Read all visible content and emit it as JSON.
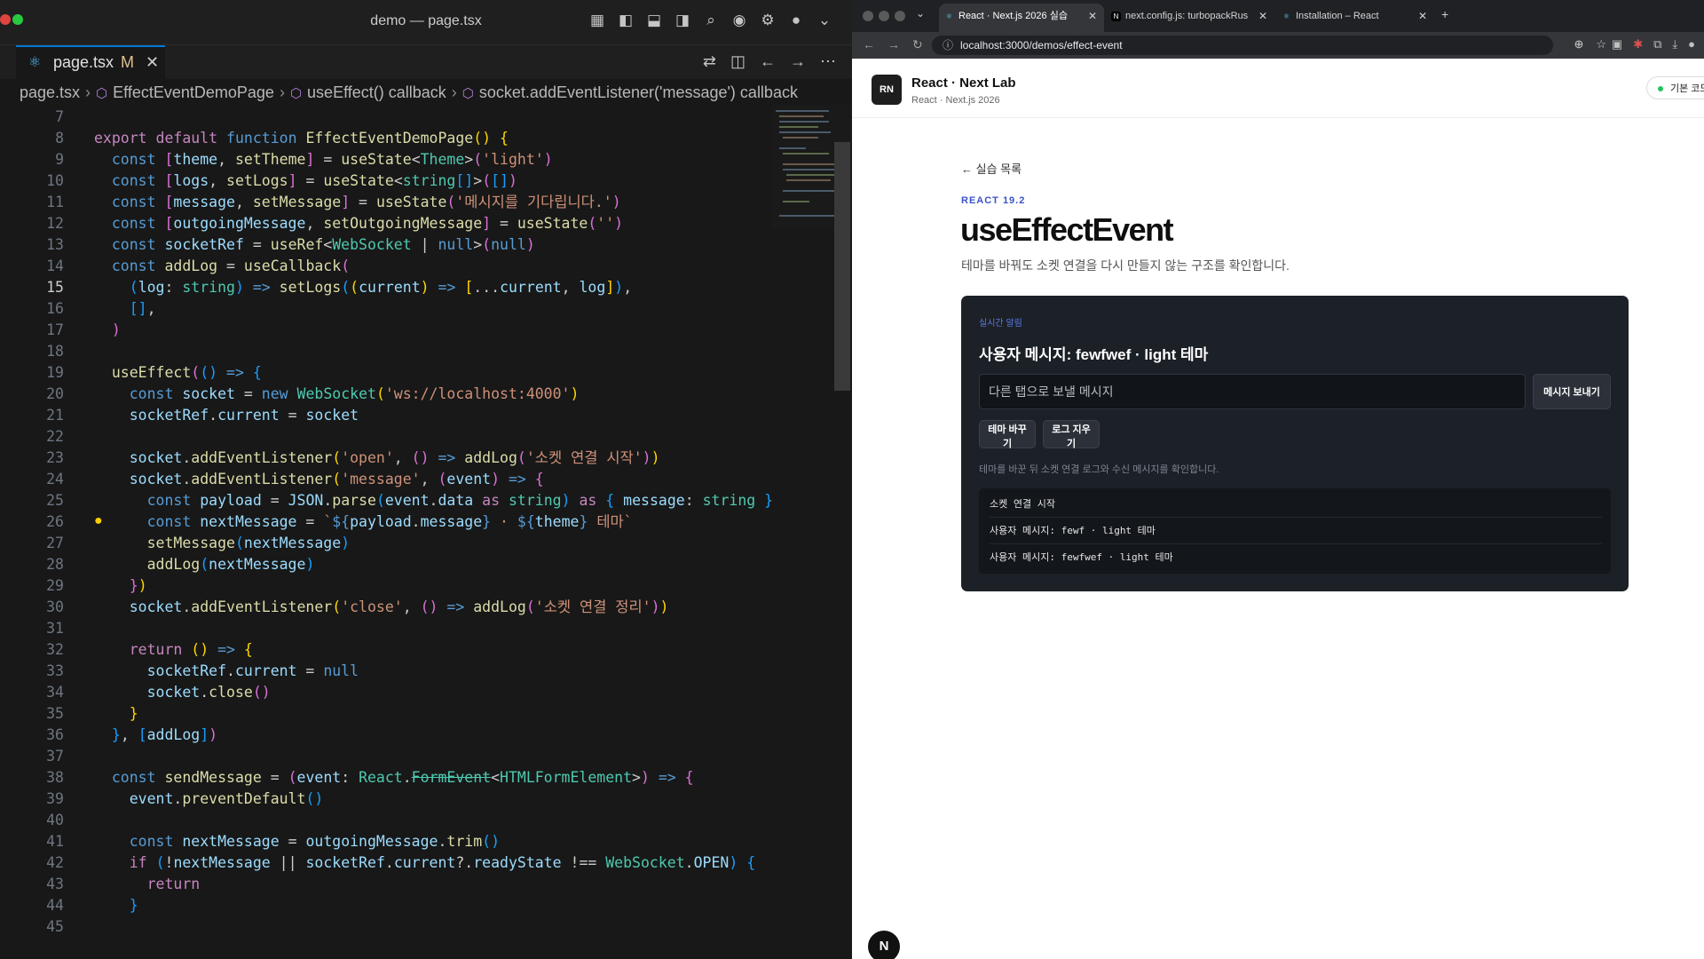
{
  "editor": {
    "window_title": "demo — page.tsx",
    "tab": {
      "icon": "⚛",
      "name": "page.tsx",
      "modified": "M",
      "close": "✕"
    },
    "breadcrumb": [
      "page.tsx",
      "EffectEventDemoPage",
      "useEffect() callback",
      "socket.addEventListener('message') callback"
    ],
    "active_line": "15",
    "lines": [
      {
        "n": "7",
        "html": ""
      },
      {
        "n": "8",
        "html": "<span class=\"kc\">export</span> <span class=\"kc\">default</span> <span class=\"kw\">function</span> <span class=\"fn\">EffectEventDemoPage</span><span class=\"bk1\">()</span> <span class=\"bk1\">{</span>"
      },
      {
        "n": "9",
        "html": "  <span class=\"kw\">const</span> <span class=\"bk2\">[</span><span class=\"vr\">theme</span>, <span class=\"fn\">setTheme</span><span class=\"bk2\">]</span> = <span class=\"fn\">useState</span>&lt;<span class=\"ty\">Theme</span>&gt;<span class=\"bk2\">(</span><span class=\"st\">'light'</span><span class=\"bk2\">)</span>"
      },
      {
        "n": "10",
        "html": "  <span class=\"kw\">const</span> <span class=\"bk2\">[</span><span class=\"vr\">logs</span>, <span class=\"fn\">setLogs</span><span class=\"bk2\">]</span> = <span class=\"fn\">useState</span>&lt;<span class=\"ty\">string</span><span class=\"bk3\">[]</span>&gt;<span class=\"bk2\">(</span><span class=\"bk3\">[]</span><span class=\"bk2\">)</span>"
      },
      {
        "n": "11",
        "html": "  <span class=\"kw\">const</span> <span class=\"bk2\">[</span><span class=\"vr\">message</span>, <span class=\"fn\">setMessage</span><span class=\"bk2\">]</span> = <span class=\"fn\">useState</span><span class=\"bk2\">(</span><span class=\"st\">'메시지를 기다립니다.'</span><span class=\"bk2\">)</span>"
      },
      {
        "n": "12",
        "html": "  <span class=\"kw\">const</span> <span class=\"bk2\">[</span><span class=\"vr\">outgoingMessage</span>, <span class=\"fn\">setOutgoingMessage</span><span class=\"bk2\">]</span> = <span class=\"fn\">useState</span><span class=\"bk2\">(</span><span class=\"st\">''</span><span class=\"bk2\">)</span>"
      },
      {
        "n": "13",
        "html": "  <span class=\"kw\">const</span> <span class=\"vr\">socketRef</span> = <span class=\"fn\">useRef</span>&lt;<span class=\"ty\">WebSocket</span> | <span class=\"kw\">null</span>&gt;<span class=\"bk2\">(</span><span class=\"kw\">null</span><span class=\"bk2\">)</span>"
      },
      {
        "n": "14",
        "html": "  <span class=\"kw\">const</span> <span class=\"fn\">addLog</span> = <span class=\"fn\">useCallback</span><span class=\"bk2\">(</span>"
      },
      {
        "n": "15",
        "html": "    <span class=\"bk3\">(</span><span class=\"vr\">log</span>: <span class=\"ty\">string</span><span class=\"bk3\">)</span> <span class=\"kw\">=&gt;</span> <span class=\"fn\">setLogs</span><span class=\"bk3\">(</span><span class=\"bk1\">(</span><span class=\"vr\">current</span><span class=\"bk1\">)</span> <span class=\"kw\">=&gt;</span> <span class=\"bk1\">[</span>...<span class=\"vr\">current</span>, <span class=\"vr\">log</span><span class=\"bk1\">]</span><span class=\"bk3\">)</span>,"
      },
      {
        "n": "16",
        "html": "    <span class=\"bk3\">[]</span>,"
      },
      {
        "n": "17",
        "html": "  <span class=\"bk2\">)</span>"
      },
      {
        "n": "18",
        "html": ""
      },
      {
        "n": "19",
        "html": "  <span class=\"fn\">useEffect</span><span class=\"bk2\">(</span><span class=\"bk3\">()</span> <span class=\"kw\">=&gt;</span> <span class=\"bk3\">{</span>"
      },
      {
        "n": "20",
        "html": "    <span class=\"kw\">const</span> <span class=\"vr\">socket</span> = <span class=\"kw\">new</span> <span class=\"ty\">WebSocket</span><span class=\"bk1\">(</span><span class=\"st\">'ws://localhost:4000'</span><span class=\"bk1\">)</span>"
      },
      {
        "n": "21",
        "html": "    <span class=\"vr\">socketRef</span>.<span class=\"vr\">current</span> = <span class=\"vr\">socket</span>"
      },
      {
        "n": "22",
        "html": ""
      },
      {
        "n": "23",
        "html": "    <span class=\"vr\">socket</span>.<span class=\"fn\">addEventListener</span><span class=\"bk1\">(</span><span class=\"st\">'open'</span>, <span class=\"bk2\">()</span> <span class=\"kw\">=&gt;</span> <span class=\"fn\">addLog</span><span class=\"bk2\">(</span><span class=\"st\">'소켓 연결 시작'</span><span class=\"bk2\">)</span><span class=\"bk1\">)</span>"
      },
      {
        "n": "24",
        "html": "    <span class=\"vr\">socket</span>.<span class=\"fn\">addEventListener</span><span class=\"bk1\">(</span><span class=\"st\">'message'</span>, <span class=\"bk2\">(</span><span class=\"vr\">event</span><span class=\"bk2\">)</span> <span class=\"kw\">=&gt;</span> <span class=\"bk2\">{</span>"
      },
      {
        "n": "25",
        "html": "      <span class=\"kw\">const</span> <span class=\"vr\">payload</span> = <span class=\"vr\">JSON</span>.<span class=\"fn\">parse</span><span class=\"bk3\">(</span><span class=\"vr\">event</span>.<span class=\"vr\">data</span> <span class=\"kc\">as</span> <span class=\"ty\">string</span><span class=\"bk3\">)</span> <span class=\"kc\">as</span> <span class=\"bk3\">{</span> <span class=\"vr\">message</span>: <span class=\"ty\">string</span> <span class=\"bk3\">}</span>"
      },
      {
        "n": "26",
        "html": "      <span class=\"kw\">const</span> <span class=\"vr\">nextMessage</span> = <span class=\"st\">`</span><span class=\"kw\">${</span><span class=\"vr\">payload</span>.<span class=\"vr\">message</span><span class=\"kw\">}</span><span class=\"st\"> · </span><span class=\"kw\">${</span><span class=\"vr\">theme</span><span class=\"kw\">}</span><span class=\"st\"> 테마`</span>"
      },
      {
        "n": "27",
        "html": "      <span class=\"fn\">setMessage</span><span class=\"bk3\">(</span><span class=\"vr\">nextMessage</span><span class=\"bk3\">)</span>"
      },
      {
        "n": "28",
        "html": "      <span class=\"fn\">addLog</span><span class=\"bk3\">(</span><span class=\"vr\">nextMessage</span><span class=\"bk3\">)</span>"
      },
      {
        "n": "29",
        "html": "    <span class=\"bk2\">}</span><span class=\"bk1\">)</span>"
      },
      {
        "n": "30",
        "html": "    <span class=\"vr\">socket</span>.<span class=\"fn\">addEventListener</span><span class=\"bk1\">(</span><span class=\"st\">'close'</span>, <span class=\"bk2\">()</span> <span class=\"kw\">=&gt;</span> <span class=\"fn\">addLog</span><span class=\"bk2\">(</span><span class=\"st\">'소켓 연결 정리'</span><span class=\"bk2\">)</span><span class=\"bk1\">)</span>"
      },
      {
        "n": "31",
        "html": ""
      },
      {
        "n": "32",
        "html": "    <span class=\"kc\">return</span> <span class=\"bk1\">()</span> <span class=\"kw\">=&gt;</span> <span class=\"bk1\">{</span>"
      },
      {
        "n": "33",
        "html": "      <span class=\"vr\">socketRef</span>.<span class=\"vr\">current</span> = <span class=\"kw\">null</span>"
      },
      {
        "n": "34",
        "html": "      <span class=\"vr\">socket</span>.<span class=\"fn\">close</span><span class=\"bk2\">()</span>"
      },
      {
        "n": "35",
        "html": "    <span class=\"bk1\">}</span>"
      },
      {
        "n": "36",
        "html": "  <span class=\"bk3\">}</span>, <span class=\"bk3\">[</span><span class=\"vr\">addLog</span><span class=\"bk3\">]</span><span class=\"bk2\">)</span>"
      },
      {
        "n": "37",
        "html": ""
      },
      {
        "n": "38",
        "html": "  <span class=\"kw\">const</span> <span class=\"fn\">sendMessage</span> = <span class=\"bk2\">(</span><span class=\"vr\">event</span>: <span class=\"ty\">React</span>.<span class=\"ty\" style=\"text-decoration:line-through\">FormEvent</span>&lt;<span class=\"ty\">HTMLFormElement</span>&gt;<span class=\"bk2\">)</span> <span class=\"kw\">=&gt;</span> <span class=\"bk2\">{</span>"
      },
      {
        "n": "39",
        "html": "    <span class=\"vr\">event</span>.<span class=\"fn\">preventDefault</span><span class=\"bk3\">()</span>"
      },
      {
        "n": "40",
        "html": ""
      },
      {
        "n": "41",
        "html": "    <span class=\"kw\">const</span> <span class=\"vr\">nextMessage</span> = <span class=\"vr\">outgoingMessage</span>.<span class=\"fn\">trim</span><span class=\"bk3\">()</span>"
      },
      {
        "n": "42",
        "html": "    <span class=\"kc\">if</span> <span class=\"bk3\">(</span>!<span class=\"vr\">nextMessage</span> || <span class=\"vr\">socketRef</span>.<span class=\"vr\">current</span>?.<span class=\"vr\">readyState</span> !== <span class=\"ty\">WebSocket</span>.<span class=\"vr\">OPEN</span><span class=\"bk3\">)</span> <span class=\"bk3\">{</span>"
      },
      {
        "n": "43",
        "html": "      <span class=\"kc\">return</span>"
      },
      {
        "n": "44",
        "html": "    <span class=\"bk3\">}</span>"
      },
      {
        "n": "45",
        "html": ""
      }
    ]
  },
  "browser": {
    "tabs": [
      {
        "label": "React · Next.js 2026 실습",
        "favicon": "⚛"
      },
      {
        "label": "next.config.js: turbopackRus",
        "favicon": "N"
      },
      {
        "label": "Installation – React",
        "favicon": "⚛"
      }
    ],
    "url": "localhost:3000/demos/effect-event",
    "site": {
      "logo": "RN",
      "title": "React · Next Lab",
      "subtitle": "React · Next.js 2026",
      "pill": "기본 코드"
    },
    "page": {
      "back_link": "← 실습 목록",
      "eyebrow": "REACT 19.2",
      "title": "useEffectEvent",
      "description": "테마를 바꿔도 소켓 연결을 다시 만들지 않는 구조를 확인합니다.",
      "panel": {
        "label": "실시간 알림",
        "message": "사용자 메시지: fewfwef · light 테마",
        "input_placeholder": "다른 탭으로 보낼 메시지",
        "input_value": "",
        "send_button": "메시지 보내기",
        "theme_button": "테마 바꾸기",
        "clear_button": "로그 지우기",
        "note": "테마를 바꾼 뒤 소켓 연결 로그와 수신 메시지를 확인합니다.",
        "logs": [
          "소켓 연결 시작",
          "사용자 메시지: fewf · light 테마",
          "사용자 메시지: fewfwef · light 테마"
        ]
      },
      "badge": "N"
    }
  },
  "colors": {
    "editor_bg": "#181818",
    "accent": "#0078d4",
    "panel_bg": "#1c2027",
    "eyebrow": "#3a53c8"
  }
}
